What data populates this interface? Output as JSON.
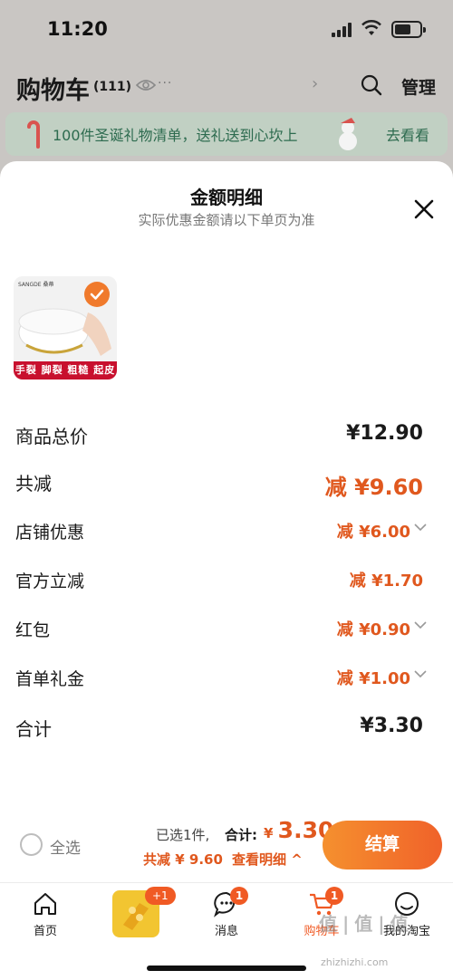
{
  "status_bar": {
    "time": "11:20"
  },
  "cart_header": {
    "title": "购物车",
    "count": "(111)",
    "more": "...",
    "manage": "管理"
  },
  "promo_banner": {
    "text": "100件圣诞礼物清单，送礼送到心坎上",
    "link": "去看看"
  },
  "sheet": {
    "title": "金额明细",
    "subtitle": "实际优惠金额请以下单页为准"
  },
  "product": {
    "brand": "SANGDE 桑蒂",
    "banner": "手裂 脚裂 粗糙 起皮"
  },
  "rows": [
    {
      "label": "商品总价",
      "value": "¥12.90"
    },
    {
      "label": "共减",
      "value": "减 ¥9.60"
    },
    {
      "label": "店铺优惠",
      "value": "减 ¥6.00"
    },
    {
      "label": "官方立减",
      "value": "减 ¥1.70"
    },
    {
      "label": "红包",
      "value": "减 ¥0.90"
    },
    {
      "label": "首单礼金",
      "value": "减 ¥1.00"
    },
    {
      "label": "合计",
      "value": "¥3.30"
    }
  ],
  "bottom_bar": {
    "select_all": "全选",
    "selected": "已选1件,",
    "total_label": "合计:",
    "total_currency": "¥",
    "total_value": "3.30",
    "save": "共减 ¥ 9.60",
    "detail_link": "查看明细 ^",
    "checkout": "结算"
  },
  "tabbar": {
    "promo_badge": "+1",
    "tabs": [
      {
        "label": "首页",
        "badge": ""
      },
      {
        "label": "消息",
        "badge": "1"
      },
      {
        "label": "购物车",
        "badge": "1"
      },
      {
        "label": "我的淘宝",
        "badge": ""
      }
    ]
  },
  "watermark": {
    "main": "值|值|值",
    "sub": "zhizhizhi.com"
  },
  "colors": {
    "accent": "#f05a24",
    "price_orange": "#e0581e",
    "banner_green": "#2d6b4f"
  }
}
